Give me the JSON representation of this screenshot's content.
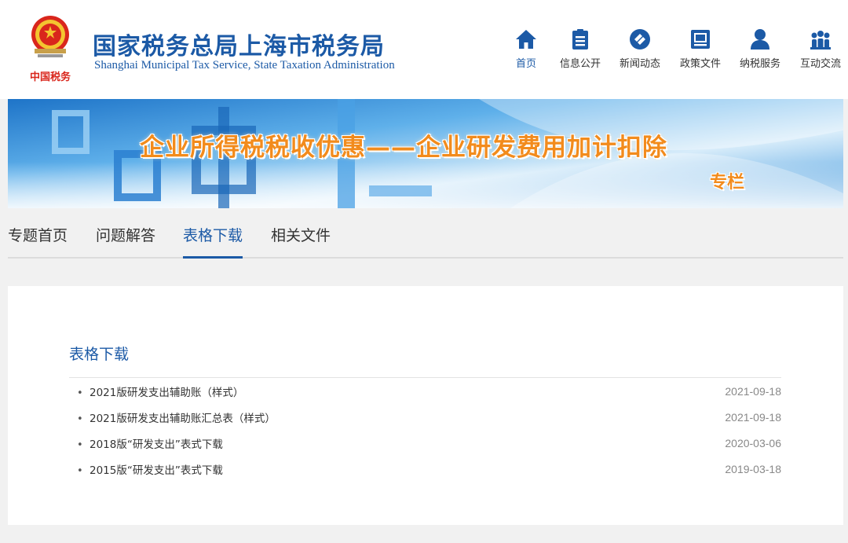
{
  "header": {
    "emblem_text": "中国税务",
    "title_cn": "国家税务总局上海市税务局",
    "title_en": "Shanghai Municipal Tax Service, State Taxation Administration"
  },
  "nav": [
    {
      "label": "首页",
      "icon": "home-icon",
      "active": true
    },
    {
      "label": "信息公开",
      "icon": "document-list-icon",
      "active": false
    },
    {
      "label": "新闻动态",
      "icon": "news-icon",
      "active": false
    },
    {
      "label": "政策文件",
      "icon": "policy-file-icon",
      "active": false
    },
    {
      "label": "纳税服务",
      "icon": "user-service-icon",
      "active": false
    },
    {
      "label": "互动交流",
      "icon": "people-group-icon",
      "active": false
    }
  ],
  "banner": {
    "title": "企业所得税税收优惠——企业研发费用加计扣除",
    "subtitle": "专栏"
  },
  "tabs": [
    {
      "label": "专题首页",
      "active": false
    },
    {
      "label": "问题解答",
      "active": false
    },
    {
      "label": "表格下载",
      "active": true
    },
    {
      "label": "相关文件",
      "active": false
    }
  ],
  "section": {
    "title": "表格下载",
    "items": [
      {
        "title": "2021版研发支出辅助账（样式）",
        "date": "2021-09-18"
      },
      {
        "title": "2021版研发支出辅助账汇总表（样式）",
        "date": "2021-09-18"
      },
      {
        "title": "2018版“研发支出”表式下载",
        "date": "2020-03-06"
      },
      {
        "title": "2015版“研发支出”表式下载",
        "date": "2019-03-18"
      }
    ]
  },
  "colors": {
    "brand_blue": "#1c5aa6",
    "banner_orange": "#f28b1c",
    "page_bg": "#f1f1f1"
  }
}
